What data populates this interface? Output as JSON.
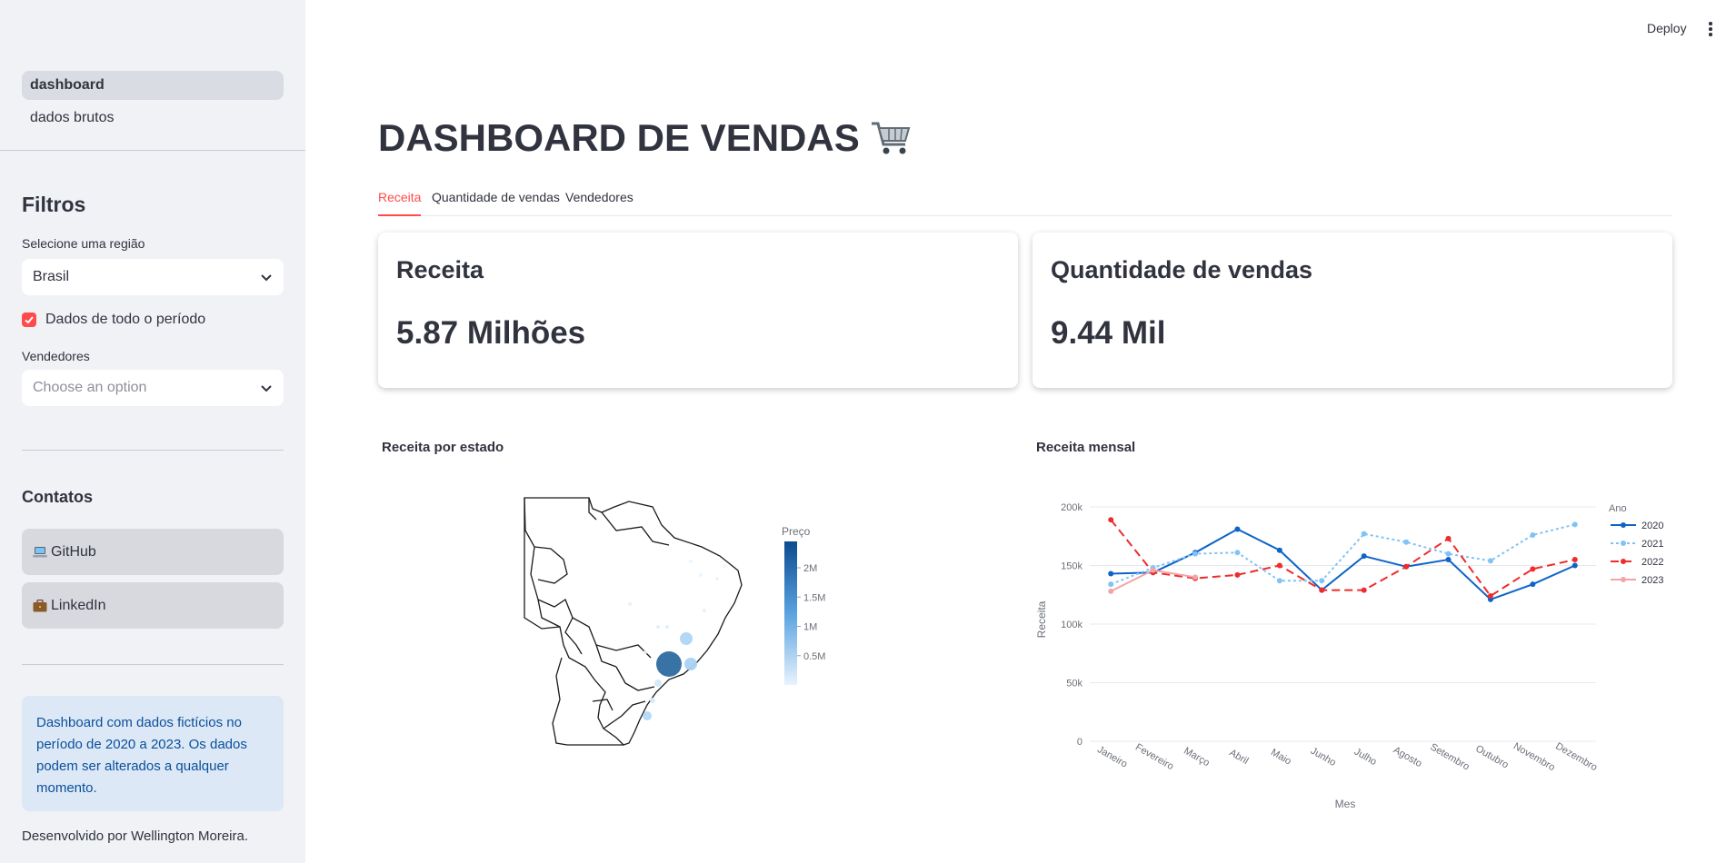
{
  "sidebar": {
    "nav": [
      {
        "label": "dashboard",
        "active": true
      },
      {
        "label": "dados brutos",
        "active": false
      }
    ],
    "filters_title": "Filtros",
    "region_label": "Selecione uma região",
    "region_value": "Brasil",
    "period_checkbox_label": "Dados de todo o período",
    "period_checked": true,
    "sellers_label": "Vendedores",
    "sellers_placeholder": "Choose an option",
    "contacts_title": "Contatos",
    "contacts": [
      {
        "icon": "laptop-icon",
        "label": "GitHub"
      },
      {
        "icon": "briefcase-icon",
        "label": "LinkedIn"
      }
    ],
    "info_text": "Dashboard com dados fictícios no período de 2020 a 2023. Os dados podem ser alterados a qualquer momento.",
    "footer_text": "Desenvolvido por Wellington Moreira."
  },
  "header": {
    "deploy_label": "Deploy",
    "menu_icon": "kebab-menu-icon"
  },
  "main": {
    "title": "DASHBOARD DE VENDAS",
    "title_icon": "shopping-cart-icon",
    "tabs": [
      {
        "label": "Receita",
        "active": true
      },
      {
        "label": "Quantidade de vendas",
        "active": false
      },
      {
        "label": "Vendedores",
        "active": false
      }
    ],
    "metrics": [
      {
        "label": "Receita",
        "value": "5.87 Milhões"
      },
      {
        "label": "Quantidade de vendas",
        "value": "9.44 Mil"
      }
    ],
    "map_chart": {
      "title": "Receita por estado",
      "colorbar_title": "Preço",
      "colorbar_ticks": [
        "2M",
        "1.5M",
        "1M",
        "0.5M"
      ],
      "colorbar_values": [
        2000000,
        1500000,
        1000000,
        500000
      ],
      "colorbar_range": [
        0,
        2450000
      ]
    },
    "line_chart_title": "Receita mensal"
  },
  "colors": {
    "accent": "#ff4b4b",
    "series_2020": "#0d64c8",
    "series_2021": "#82c3f5",
    "series_2022": "#ef2b2b",
    "series_2023": "#f4a4a8"
  },
  "chart_data": {
    "type": "line",
    "title": "Receita mensal",
    "xlabel": "Mes",
    "ylabel": "Receita",
    "categories": [
      "Janeiro",
      "Fevereiro",
      "Março",
      "Abril",
      "Maio",
      "Junho",
      "Julho",
      "Agosto",
      "Setembro",
      "Outubro",
      "Novembro",
      "Dezembro"
    ],
    "ylim": [
      0,
      200000
    ],
    "yticks": [
      0,
      50000,
      100000,
      150000,
      200000
    ],
    "ytick_labels": [
      "0",
      "50k",
      "100k",
      "150k",
      "200k"
    ],
    "grid": true,
    "legend_title": "Ano",
    "legend_position": "right",
    "series": [
      {
        "name": "2020",
        "style": "solid",
        "values": [
          143000,
          144000,
          161000,
          181000,
          163000,
          129000,
          158000,
          149000,
          155000,
          121000,
          134000,
          150000
        ]
      },
      {
        "name": "2021",
        "style": "dotted",
        "values": [
          134000,
          148000,
          160000,
          161000,
          137000,
          137000,
          177000,
          170000,
          160000,
          154000,
          176000,
          185000
        ]
      },
      {
        "name": "2022",
        "style": "dashed",
        "values": [
          189000,
          144000,
          139000,
          142000,
          150000,
          129000,
          129000,
          149000,
          173000,
          124000,
          147000,
          155000
        ]
      },
      {
        "name": "2023",
        "style": "solid",
        "values": [
          128000,
          146000,
          140000
        ]
      }
    ]
  }
}
